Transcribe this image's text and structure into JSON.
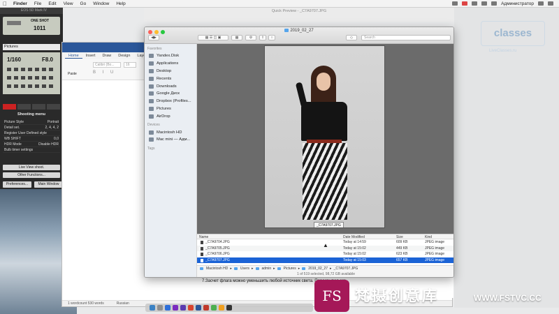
{
  "menubar": {
    "items": [
      "Finder",
      "File",
      "Edit",
      "View",
      "Go",
      "Window",
      "Help"
    ],
    "user": "Администратор"
  },
  "canon": {
    "window_title": "EOS 5D Mark IV",
    "lcd_mode": "ONE SHOT",
    "lcd_count": "1011",
    "save_dest": "Pictures",
    "shutter": "1/160",
    "aperture": "F8.0",
    "menu_title": "Shooting menu",
    "menu_rows": [
      {
        "key": "Picture Style",
        "value": "Portrait"
      },
      {
        "key": "Detail set.",
        "value": "2, 4, 4, 2"
      },
      {
        "key": "Register User Defined style",
        "value": ""
      },
      {
        "key": "WB SHIFT",
        "value": "0,0"
      },
      {
        "key": "HDR Mode",
        "value": "Disable HDR"
      },
      {
        "key": "Bulb timer settings",
        "value": ""
      }
    ],
    "live_view_button": "Live View shoot.",
    "other_functions_button": "Other Functions...",
    "preferences_button": "Preferences...",
    "main_window_button": "Main Window"
  },
  "word": {
    "ribbon_tabs": [
      "Home",
      "Insert",
      "Draw",
      "Design",
      "Layout"
    ],
    "paste_label": "Paste",
    "font_name": "Calibri (Bo...",
    "font_size": "16",
    "format_buttons": "B I U",
    "body_text": "7.Засчет флага можно уменьшить любой источник света. Перекрывая его.",
    "status_words": "1 wordcount 530 words",
    "status_language": "Russian"
  },
  "quicklook_title": "Quick Preview - _C7A9707.JPG",
  "finder": {
    "title": "2019_02_27",
    "search_placeholder": "Search",
    "sidebar": {
      "favorites_heading": "Favorites",
      "favorites": [
        "Yandex.Disk",
        "Applications",
        "Desktop",
        "Recents",
        "Downloads",
        "Google Диск",
        "Dropbox (Profiles...",
        "Pictures",
        "AirDrop"
      ],
      "devices_heading": "Devices",
      "devices": [
        "Macintosh HD",
        "Mac mini — Адм..."
      ],
      "tags_heading": "Tags"
    },
    "preview_caption": "_C7A9707.JPG",
    "columns": {
      "name": "Name",
      "date": "Date Modified",
      "size": "Size",
      "kind": "Kind"
    },
    "rows": [
      {
        "name": "_C7A9704.JPG",
        "date": "Today at 14:59",
        "size": "609 KB",
        "kind": "JPEG image"
      },
      {
        "name": "_C7A9705.JPG",
        "date": "Today at 15:02",
        "size": "449 KB",
        "kind": "JPEG image"
      },
      {
        "name": "_C7A9706.JPG",
        "date": "Today at 15:02",
        "size": "623 KB",
        "kind": "JPEG image"
      },
      {
        "name": "_C7A9707.JPG",
        "date": "Today at 15:03",
        "size": "657 KB",
        "kind": "JPEG image"
      }
    ],
    "path": [
      "Macintosh HD",
      "Users",
      "admin",
      "Pictures",
      "2019_02_27",
      "_C7A9707.JPG"
    ],
    "status": "1 of 519 selected, 98,72 GB available"
  },
  "watermark": {
    "classes": "classes",
    "classes_sub": "LiveClasses.ru",
    "brand_mark": "FS",
    "brand_cn": "梵摄创意库",
    "brand_url": "WWW.FSTVC.CC"
  },
  "colors": {
    "selection": "#1b63d6",
    "word_blue": "#2b579a",
    "brand": "#a51858"
  }
}
